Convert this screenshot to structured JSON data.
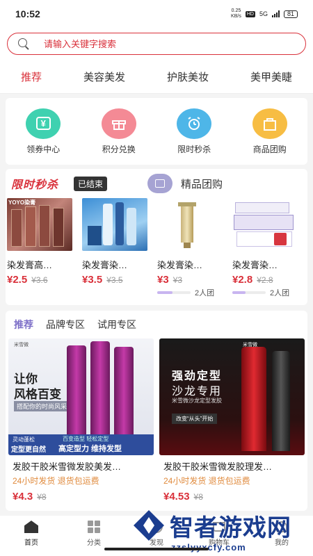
{
  "status_bar": {
    "time": "10:52",
    "net_speed": "0.25",
    "net_unit": "KB/s",
    "hd": "HD",
    "signal": "5G",
    "battery": "81"
  },
  "search": {
    "placeholder": "请输入关键字搜索"
  },
  "category_tabs": [
    {
      "label": "推荐",
      "active": true
    },
    {
      "label": "美容美发",
      "active": false
    },
    {
      "label": "护肤美妆",
      "active": false
    },
    {
      "label": "美甲美睫",
      "active": false
    }
  ],
  "quick_entries": [
    {
      "label": "领券中心",
      "icon": "coupon-icon",
      "color": "#3fd1b0",
      "glyph": "¥"
    },
    {
      "label": "积分兑换",
      "icon": "gift-icon",
      "color": "#f48a95",
      "glyph": ""
    },
    {
      "label": "限时秒杀",
      "icon": "alarm-clock-icon",
      "color": "#4eb6e8",
      "glyph": ""
    },
    {
      "label": "商品团购",
      "icon": "shopping-bag-icon",
      "color": "#f7bd43",
      "glyph": ""
    }
  ],
  "flash_sale": {
    "title": "限时秒杀",
    "status": "已结束",
    "group_title": "精品团购",
    "products": [
      {
        "name": "染发膏高…",
        "price": "¥2.5",
        "old_price": "¥3.6",
        "img_label": "YOYO染膏"
      },
      {
        "name": "染发膏染…",
        "price": "¥3.5",
        "old_price": "¥3.5",
        "img_label": ""
      }
    ],
    "group_products": [
      {
        "name": "染发膏染…",
        "price": "¥3",
        "old_price": "¥3",
        "group_text": "2人团",
        "progress": 0.45
      },
      {
        "name": "染发膏染…",
        "price": "¥2.8",
        "old_price": "¥2.8",
        "group_text": "2人团",
        "progress": 0.4
      }
    ]
  },
  "feed": {
    "tabs": [
      {
        "label": "推荐",
        "active": true
      },
      {
        "label": "品牌专区",
        "active": false
      },
      {
        "label": "试用专区",
        "active": false
      }
    ],
    "products": [
      {
        "name": "发胶干胶米雪微发胶美发…",
        "shipping": "24小时发货 退货包运费",
        "price": "¥4.3",
        "old_price": "¥8",
        "img_line1": "让你",
        "img_line2": "风格百变",
        "img_line3": "搭配你的时尚风采",
        "img_brand": "米雪微",
        "img_bottom_left": "灵动蓬松",
        "img_bottom_tag": "定型更自然",
        "img_bottom_right1": "百变造型 轻松定型",
        "img_bottom_right2": "高定型力 维持发型"
      },
      {
        "name": "发胶干胶米雪微发胶理发…",
        "shipping": "24小时发货 退货包运费",
        "price": "¥4.53",
        "old_price": "¥8",
        "img_line1": "强劲定型",
        "img_line2": "沙龙专用",
        "img_line3": "米雪微沙龙定型发胶",
        "img_brand": "米雪微",
        "img_sub": "改变“从头”开始"
      }
    ]
  },
  "bottom_nav": [
    {
      "label": "首页",
      "icon": "home-icon",
      "active": true
    },
    {
      "label": "分类",
      "icon": "category-icon",
      "active": false
    },
    {
      "label": "发现",
      "icon": "discover-icon",
      "active": false
    },
    {
      "label": "购物车",
      "icon": "cart-icon",
      "active": false
    },
    {
      "label": "我的",
      "icon": "profile-icon",
      "active": false
    }
  ],
  "watermark": {
    "text": "智者游戏网",
    "url": "zzslyyxcfy.com"
  }
}
